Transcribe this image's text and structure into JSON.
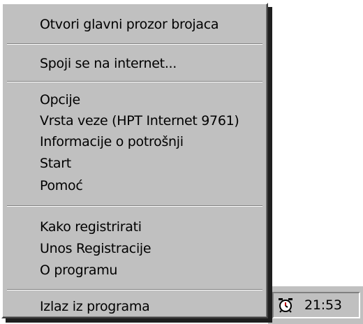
{
  "menu": {
    "items": [
      {
        "label": "Otvori glavni prozor brojaca"
      },
      {
        "label": "Spoji se na internet..."
      },
      {
        "label": "Opcije"
      },
      {
        "label": "Vrsta veze (HPT Internet 9761)"
      },
      {
        "label": "Informacije o potrošnji"
      },
      {
        "label": "Start"
      },
      {
        "label": "Pomoć"
      },
      {
        "label": "Kako registrirati"
      },
      {
        "label": "Unos Registracije"
      },
      {
        "label": "O programu"
      },
      {
        "label": "Izlaz iz programa"
      }
    ]
  },
  "tray": {
    "clock_icon": "alarm-clock-icon",
    "time": "21:53"
  },
  "colors": {
    "menu_bg": "#c0c0c0",
    "highlight": "#ffffff",
    "shadow": "#808080",
    "dark_shadow": "#404040",
    "drop_shadow": "#1e1e1e"
  }
}
